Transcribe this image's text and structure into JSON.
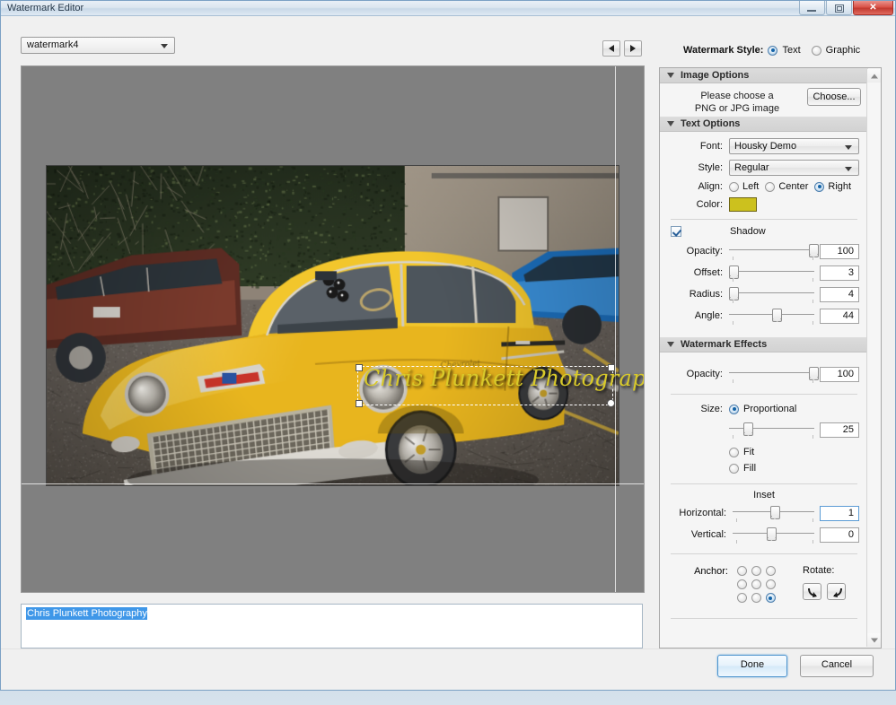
{
  "window": {
    "title": "Watermark Editor",
    "minimize": "–",
    "maximize": "▣",
    "close": "✕"
  },
  "toolbar": {
    "preset_value": "watermark4",
    "prev_label": "◀",
    "next_label": "▶"
  },
  "preview": {
    "watermark_text": "Chris Plunkett Photography"
  },
  "text_entry": {
    "value": "Chris Plunkett Photography"
  },
  "style_row": {
    "label": "Watermark Style:",
    "options": [
      {
        "label": "Text",
        "selected": true
      },
      {
        "label": "Graphic",
        "selected": false
      }
    ]
  },
  "image_options": {
    "header": "Image Options",
    "message_line1": "Please choose a",
    "message_line2": "PNG or JPG image",
    "choose_label": "Choose..."
  },
  "text_options": {
    "header": "Text Options",
    "font_label": "Font:",
    "font_value": "Housky Demo",
    "style_label": "Style:",
    "style_value": "Regular",
    "align_label": "Align:",
    "align_options": [
      {
        "label": "Left",
        "selected": false
      },
      {
        "label": "Center",
        "selected": false
      },
      {
        "label": "Right",
        "selected": true
      }
    ],
    "color_label": "Color:",
    "color_value": "#ccc11e",
    "shadow_label": "Shadow",
    "shadow_checked": true,
    "shadow_opacity_label": "Opacity:",
    "shadow_opacity_value": "100",
    "shadow_offset_label": "Offset:",
    "shadow_offset_value": "3",
    "shadow_radius_label": "Radius:",
    "shadow_radius_value": "4",
    "shadow_angle_label": "Angle:",
    "shadow_angle_value": "44"
  },
  "watermark_effects": {
    "header": "Watermark Effects",
    "opacity_label": "Opacity:",
    "opacity_value": "100",
    "size_label": "Size:",
    "size_options": [
      {
        "label": "Proportional",
        "selected": true
      },
      {
        "label": "Fit",
        "selected": false
      },
      {
        "label": "Fill",
        "selected": false
      }
    ],
    "size_value": "25",
    "inset_label": "Inset",
    "horizontal_label": "Horizontal:",
    "horizontal_value": "1",
    "vertical_label": "Vertical:",
    "vertical_value": "0",
    "anchor_label": "Anchor:",
    "anchor_selected_index": 8,
    "rotate_label": "Rotate:",
    "rotate_left_icon": "rotate-ccw-icon",
    "rotate_right_icon": "rotate-cw-icon"
  },
  "footer": {
    "done_label": "Done",
    "cancel_label": "Cancel"
  }
}
